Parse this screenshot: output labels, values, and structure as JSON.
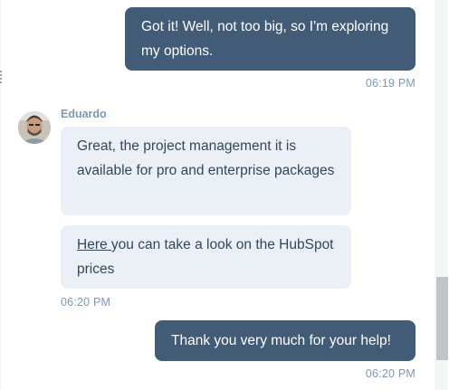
{
  "messages": [
    {
      "text": "Got it! Well, not too big, so I'm exploring my options."
    },
    {
      "time": "06:19 PM"
    },
    {
      "sender": "Eduardo"
    },
    {
      "text": "Great, the project management it is available for pro and enterprise packages"
    },
    {
      "link": "Here ",
      "text": "you can take a look on the HubSpot prices"
    },
    {
      "time": "06:20 PM"
    },
    {
      "text": "Thank you very much for your help!"
    },
    {
      "time": "06:20 PM"
    }
  ],
  "colors": {
    "outgoing_bubble": "#425b76",
    "incoming_bubble": "#eaf0f6",
    "timestamp": "#7c98b6"
  }
}
